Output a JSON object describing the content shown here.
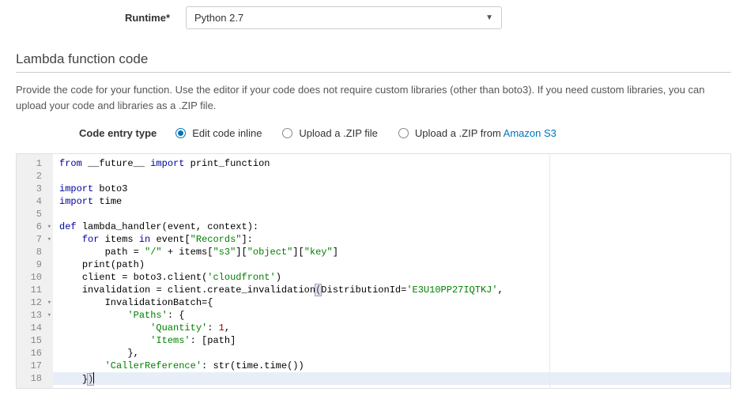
{
  "runtime": {
    "label": "Runtime*",
    "selected": "Python 2.7"
  },
  "section": {
    "header": "Lambda function code",
    "description": "Provide the code for your function. Use the editor if your code does not require custom libraries (other than boto3). If you need custom libraries, you can upload your code and libraries as a .ZIP file."
  },
  "entry": {
    "label": "Code entry type",
    "options": [
      {
        "label": "Edit code inline",
        "selected": true
      },
      {
        "label": "Upload a .ZIP file",
        "selected": false
      }
    ],
    "s3_option_prefix": "Upload a .ZIP from ",
    "s3_option_link": "Amazon S3"
  },
  "code": {
    "lines": [
      {
        "n": 1,
        "fold": "",
        "tokens": [
          [
            "kw",
            "from"
          ],
          [
            "sp",
            " "
          ],
          [
            "id",
            "__future__"
          ],
          [
            "sp",
            " "
          ],
          [
            "kw",
            "import"
          ],
          [
            "sp",
            " "
          ],
          [
            "id",
            "print_function"
          ]
        ]
      },
      {
        "n": 2,
        "fold": "",
        "tokens": []
      },
      {
        "n": 3,
        "fold": "",
        "tokens": [
          [
            "kw",
            "import"
          ],
          [
            "sp",
            " "
          ],
          [
            "id",
            "boto3"
          ]
        ]
      },
      {
        "n": 4,
        "fold": "",
        "tokens": [
          [
            "kw",
            "import"
          ],
          [
            "sp",
            " "
          ],
          [
            "id",
            "time"
          ]
        ]
      },
      {
        "n": 5,
        "fold": "",
        "tokens": []
      },
      {
        "n": 6,
        "fold": "▾",
        "tokens": [
          [
            "kw",
            "def"
          ],
          [
            "sp",
            " "
          ],
          [
            "id",
            "lambda_handler"
          ],
          [
            "op",
            "("
          ],
          [
            "id",
            "event"
          ],
          [
            "op",
            ", "
          ],
          [
            "id",
            "context"
          ],
          [
            "op",
            "):"
          ]
        ]
      },
      {
        "n": 7,
        "fold": "▾",
        "tokens": [
          [
            "sp",
            "    "
          ],
          [
            "kw",
            "for"
          ],
          [
            "sp",
            " "
          ],
          [
            "id",
            "items"
          ],
          [
            "sp",
            " "
          ],
          [
            "kw",
            "in"
          ],
          [
            "sp",
            " "
          ],
          [
            "id",
            "event"
          ],
          [
            "op",
            "["
          ],
          [
            "str",
            "\"Records\""
          ],
          [
            "op",
            "]:"
          ]
        ]
      },
      {
        "n": 8,
        "fold": "",
        "tokens": [
          [
            "sp",
            "        "
          ],
          [
            "id",
            "path"
          ],
          [
            "sp",
            " "
          ],
          [
            "op",
            "="
          ],
          [
            "sp",
            " "
          ],
          [
            "str",
            "\"/\""
          ],
          [
            "sp",
            " "
          ],
          [
            "op",
            "+"
          ],
          [
            "sp",
            " "
          ],
          [
            "id",
            "items"
          ],
          [
            "op",
            "["
          ],
          [
            "str",
            "\"s3\""
          ],
          [
            "op",
            "]["
          ],
          [
            "str",
            "\"object\""
          ],
          [
            "op",
            "]["
          ],
          [
            "str",
            "\"key\""
          ],
          [
            "op",
            "]"
          ]
        ]
      },
      {
        "n": 9,
        "fold": "",
        "tokens": [
          [
            "sp",
            "    "
          ],
          [
            "id",
            "print"
          ],
          [
            "op",
            "("
          ],
          [
            "id",
            "path"
          ],
          [
            "op",
            ")"
          ]
        ]
      },
      {
        "n": 10,
        "fold": "",
        "tokens": [
          [
            "sp",
            "    "
          ],
          [
            "id",
            "client"
          ],
          [
            "sp",
            " "
          ],
          [
            "op",
            "="
          ],
          [
            "sp",
            " "
          ],
          [
            "id",
            "boto3"
          ],
          [
            "op",
            "."
          ],
          [
            "id",
            "client"
          ],
          [
            "op",
            "("
          ],
          [
            "str",
            "'cloudfront'"
          ],
          [
            "op",
            ")"
          ]
        ]
      },
      {
        "n": 11,
        "fold": "",
        "tokens": [
          [
            "sp",
            "    "
          ],
          [
            "id",
            "invalidation"
          ],
          [
            "sp",
            " "
          ],
          [
            "op",
            "="
          ],
          [
            "sp",
            " "
          ],
          [
            "id",
            "client"
          ],
          [
            "op",
            "."
          ],
          [
            "id",
            "create_invalidation"
          ],
          [
            "phl",
            "("
          ],
          [
            "id",
            "DistributionId"
          ],
          [
            "op",
            "="
          ],
          [
            "str",
            "'E3U10PP27IQTKJ'"
          ],
          [
            "op",
            ","
          ]
        ]
      },
      {
        "n": 12,
        "fold": "▾",
        "tokens": [
          [
            "sp",
            "        "
          ],
          [
            "id",
            "InvalidationBatch"
          ],
          [
            "op",
            "={"
          ]
        ]
      },
      {
        "n": 13,
        "fold": "▾",
        "tokens": [
          [
            "sp",
            "            "
          ],
          [
            "str",
            "'Paths'"
          ],
          [
            "op",
            ": {"
          ]
        ]
      },
      {
        "n": 14,
        "fold": "",
        "tokens": [
          [
            "sp",
            "                "
          ],
          [
            "str",
            "'Quantity'"
          ],
          [
            "op",
            ": "
          ],
          [
            "num",
            "1"
          ],
          [
            "op",
            ","
          ]
        ]
      },
      {
        "n": 15,
        "fold": "",
        "tokens": [
          [
            "sp",
            "                "
          ],
          [
            "str",
            "'Items'"
          ],
          [
            "op",
            ": ["
          ],
          [
            "id",
            "path"
          ],
          [
            "op",
            "]"
          ]
        ]
      },
      {
        "n": 16,
        "fold": "",
        "tokens": [
          [
            "sp",
            "            "
          ],
          [
            "op",
            "},"
          ]
        ]
      },
      {
        "n": 17,
        "fold": "",
        "tokens": [
          [
            "sp",
            "        "
          ],
          [
            "str",
            "'CallerReference'"
          ],
          [
            "op",
            ": "
          ],
          [
            "id",
            "str"
          ],
          [
            "op",
            "("
          ],
          [
            "id",
            "time"
          ],
          [
            "op",
            "."
          ],
          [
            "id",
            "time"
          ],
          [
            "op",
            "())"
          ]
        ]
      },
      {
        "n": 18,
        "fold": "",
        "active": true,
        "tokens": [
          [
            "sp",
            "    "
          ],
          [
            "op",
            "}"
          ],
          [
            "phl",
            ")"
          ],
          [
            "cursor",
            ""
          ]
        ]
      }
    ]
  }
}
